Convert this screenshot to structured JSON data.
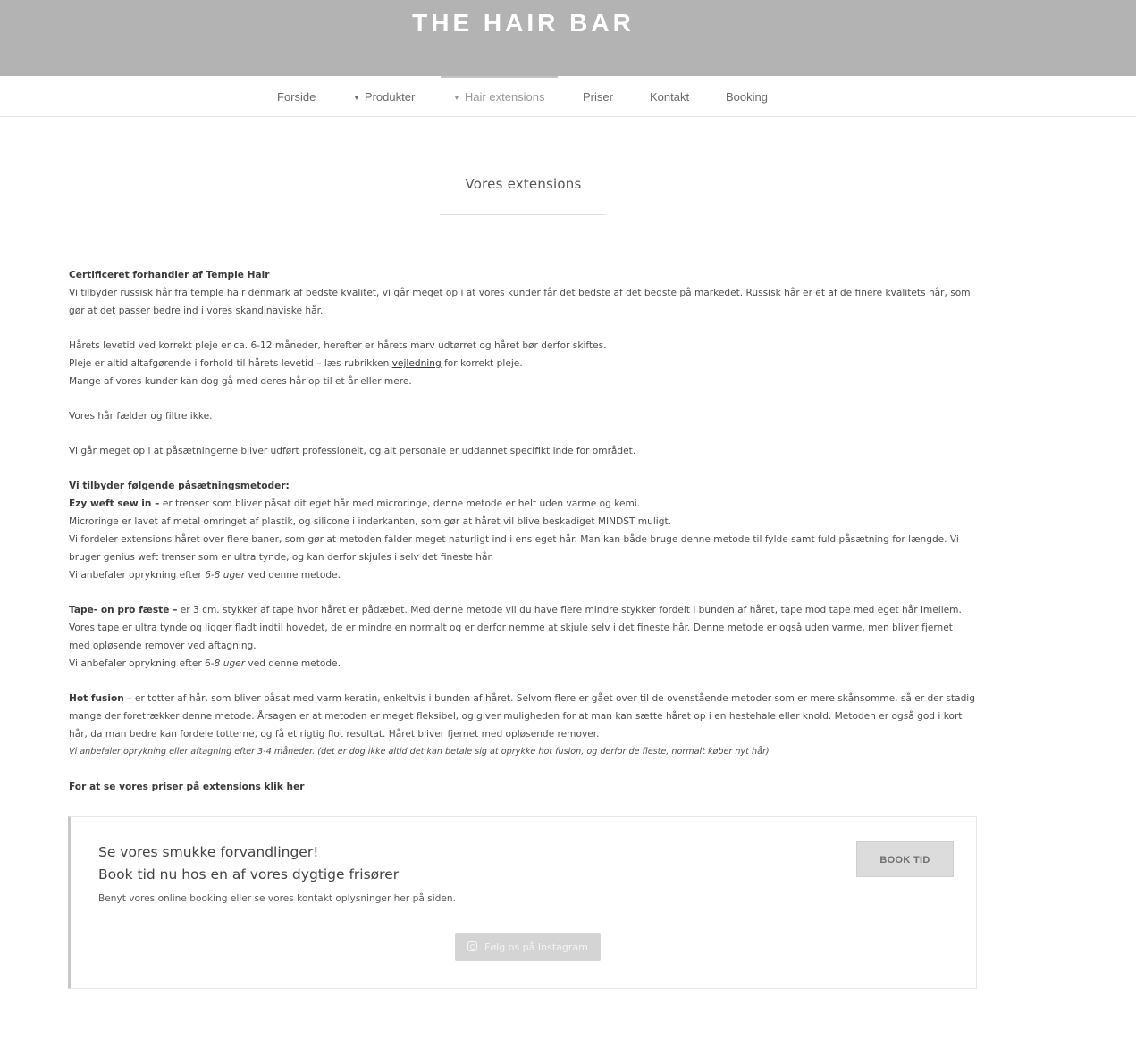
{
  "header": {
    "logo": "THE HAIR BAR"
  },
  "nav": {
    "items": [
      {
        "label": "Forside"
      },
      {
        "label": "Produkter",
        "caret": "▼"
      },
      {
        "label": "Hair extensions",
        "caret": "▼"
      },
      {
        "label": "Priser"
      },
      {
        "label": "Kontakt"
      },
      {
        "label": "Booking"
      }
    ]
  },
  "page": {
    "title": "Vores extensions"
  },
  "content": {
    "p1": {
      "heading": "Certificeret forhandler af Temple Hair",
      "text": "Vi tilbyder russisk hår fra temple hair denmark af bedste kvalitet, vi går meget op i at vores kunder får det bedste af det bedste på markedet. Russisk hår er et af de finere kvalitets hår, som gør at det passer bedre ind i vores skandinaviske hår."
    },
    "p2": {
      "line1": "Hårets levetid ved korrekt pleje er ca. 6-12 måneder, herefter er hårets marv udtørret og håret bør derfor skiftes.",
      "line2_before": "Pleje er altid altafgørende i forhold til hårets levetid – læs rubrikken ",
      "line2_link": "vejledning",
      "line2_after": " for korrekt pleje.",
      "line3": "Mange af vores kunder kan dog gå med deres hår op til et år eller mere."
    },
    "p3": "Vores hår fælder og filtre ikke.",
    "p4": "Vi går meget op i at påsætningerne bliver udført professionelt, og alt personale er uddannet specifikt inde for området.",
    "p5": {
      "heading": "Vi tilbyder følgende påsætningsmetoder:",
      "ezy_label": "Ezy weft sew in –",
      "ezy_text": " er trenser som bliver påsat dit eget hår med microringe, denne metode er helt uden varme og kemi.",
      "line2": "Microringe er lavet af metal omringet af plastik, og silicone i inderkanten, som gør at håret vil blive beskadiget MINDST muligt.",
      "line3": "Vi fordeler extensions håret over flere baner, som gør at metoden falder meget naturligt ind i ens eget hår. Man kan både bruge denne metode til fylde samt fuld påsætning for længde. Vi bruger genius weft trenser som er ultra tynde, og kan derfor skjules i selv det fineste hår.",
      "rec_before": "Vi anbefaler oprykning efter ",
      "rec_italic": "6-8 uger",
      "rec_after": " ved denne metode."
    },
    "p6": {
      "label": "Tape- on pro fæste –",
      "text": " er 3 cm. stykker af tape hvor håret er pådæbet. Med denne metode vil du have flere mindre stykker fordelt i bunden af håret, tape mod tape med eget hår imellem. Vores tape er ultra tynde og ligger fladt indtil hovedet, de er mindre en normalt og er derfor nemme at skjule selv i det fineste hår. Denne metode er også uden varme, men bliver fjernet med opløsende remover ved aftagning.",
      "rec_before": "Vi anbefaler oprykning efter 6-",
      "rec_italic": "8 uger",
      "rec_after": " ved denne metode."
    },
    "p7": {
      "label": "Hot fusion",
      "text": " – er totter af hår, som bliver påsat med varm keratin, enkeltvis i bunden af håret. Selvom flere er gået over til de ovenstående metoder som er mere skånsomme, så er der stadig mange der foretrækker denne metode. Årsagen er at metoden er meget fleksibel, og giver muligheden for at man kan sætte håret op i en hestehale eller knold. Metoden er også god i kort hår, da man bedre kan fordele totterne, og få et rigtig flot resultat. Håret bliver fjernet med opløsende remover.",
      "rec": "Vi anbefaler oprykning eller aftagning efter 3-4 måneder. (det er dog ikke altid det kan betale sig at oprykke hot fusion, og derfor de fleste, normalt køber nyt hår)"
    },
    "p8": {
      "text": "For at se vores priser på extensions ",
      "link": "klik her"
    }
  },
  "cta": {
    "title_line1": "Se vores smukke forvandlinger!",
    "title_line2": "Book tid nu hos en af vores dygtige frisører",
    "subtitle": "Benyt vores online booking eller se vores kontakt oplysninger her på siden.",
    "book_button": "BOOK TID",
    "instagram_button": "Følg os på Instagram",
    "instagram_icon": "instagram-icon"
  }
}
